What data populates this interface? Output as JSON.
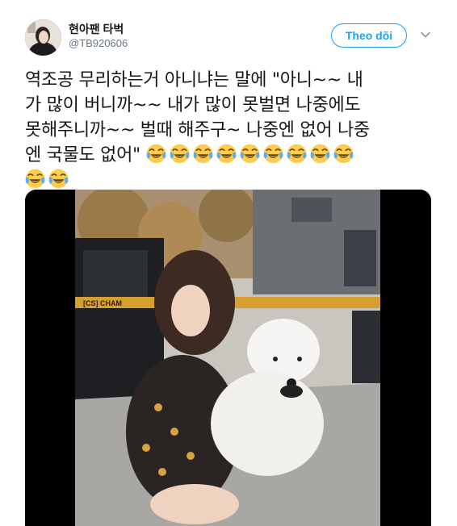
{
  "user": {
    "display_name": "현아팬 타벅",
    "handle": "@TB920606"
  },
  "follow_button_label": "Theo dõi",
  "more_menu_icon": "chevron-down-icon",
  "tweet": {
    "lines": [
      "역조공 무리하는거 아니냐는 말에 \"아니~~ 내",
      "가 많이 버니까~~ 내가 많이 못벌면 나중에도",
      "못해주니까~~ 벌때 해주구~ 나중엔 없어 나중",
      "엔 국물도 없어\""
    ],
    "emoji_name": "face-with-tears-of-joy",
    "emoji_count_line4": 9,
    "emoji_count_line5": 2
  },
  "media": {
    "banner_text": "[CS] CHAM"
  },
  "colors": {
    "accent": "#1da1f2",
    "secondary_text": "#657786",
    "primary_text": "#14171a"
  }
}
